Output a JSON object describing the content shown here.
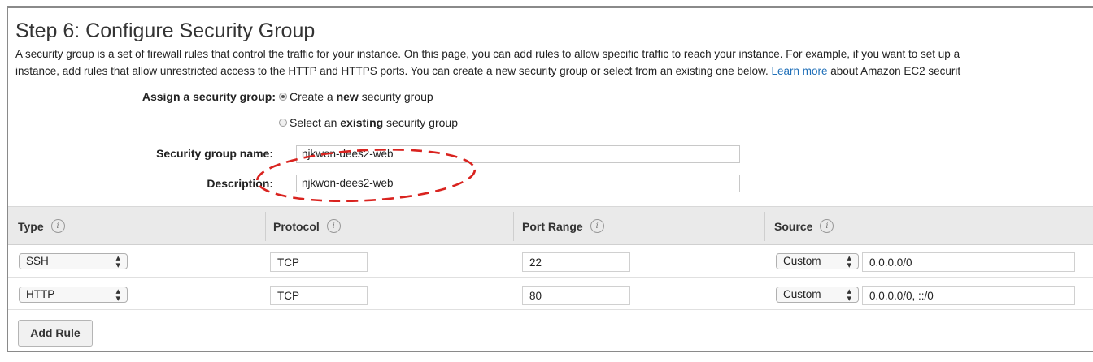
{
  "page": {
    "title": "Step 6: Configure Security Group",
    "intro_line1": "A security group is a set of firewall rules that control the traffic for your instance. On this page, you can add rules to allow specific traffic to reach your instance. For example, if you want to set up a",
    "intro_line2_before": "instance, add rules that allow unrestricted access to the HTTP and HTTPS ports. You can create a new security group or select from an existing one below. ",
    "intro_link": "Learn more",
    "intro_line2_after": " about Amazon EC2 securit"
  },
  "assign": {
    "label": "Assign a security group:",
    "option_new_prefix": "Create a ",
    "option_new_bold": "new",
    "option_new_suffix": " security group",
    "option_existing_prefix": "Select an ",
    "option_existing_bold": "existing",
    "option_existing_suffix": " security group",
    "selected": "new"
  },
  "fields": {
    "name_label": "Security group name:",
    "name_value": "njkwon-dees2-web",
    "description_label": "Description:",
    "description_value": "njkwon-dees2-web"
  },
  "table": {
    "headers": [
      "Type",
      "Protocol",
      "Port Range",
      "Source"
    ],
    "info_glyph": "i",
    "rows": [
      {
        "type": "SSH",
        "protocol": "TCP",
        "port_range": "22",
        "source_type": "Custom",
        "source_value": "0.0.0.0/0"
      },
      {
        "type": "HTTP",
        "protocol": "TCP",
        "port_range": "80",
        "source_type": "Custom",
        "source_value": "0.0.0.0/0, ::/0"
      }
    ]
  },
  "buttons": {
    "add_rule": "Add Rule"
  },
  "annotation": {
    "color": "#d9231f",
    "style": "dashed-ellipse"
  },
  "icons": {
    "select_arrows": "up-down-chevron-icon",
    "info": "info-icon"
  }
}
